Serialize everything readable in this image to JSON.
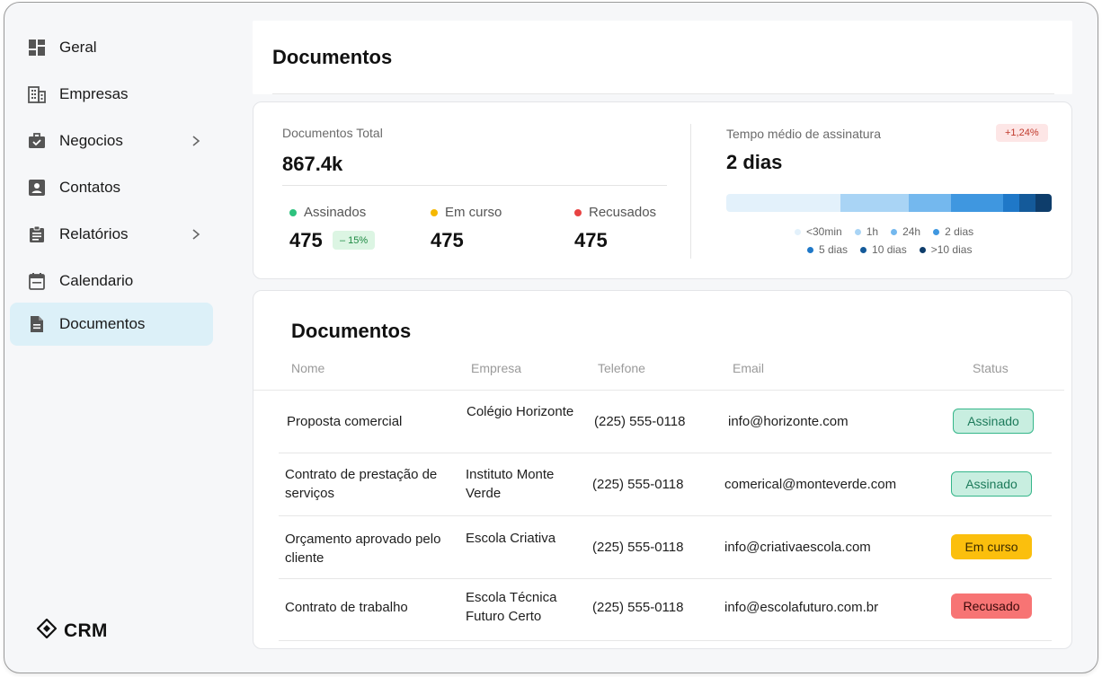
{
  "sidebar": {
    "items": [
      {
        "label": "Geral",
        "icon": "dashboard-icon"
      },
      {
        "label": "Empresas",
        "icon": "building-icon"
      },
      {
        "label": "Negocios",
        "icon": "briefcase-icon"
      },
      {
        "label": "Contatos",
        "icon": "contact-icon"
      },
      {
        "label": "Relatórios",
        "icon": "clipboard-icon"
      },
      {
        "label": "Calendario",
        "icon": "calendar-icon"
      },
      {
        "label": "Documentos",
        "icon": "document-icon"
      }
    ],
    "brand": "CRM"
  },
  "header": {
    "title": "Documentos"
  },
  "stats": {
    "total_label": "Documentos Total",
    "total_value": "867.4k",
    "assinados_label": "Assinados",
    "assinados_value": "475",
    "assinados_change": "– 15%",
    "emcurso_label": "Em curso",
    "emcurso_value": "475",
    "recusados_label": "Recusados",
    "recusados_value": "475",
    "tempo_label": "Tempo médio de assinatura",
    "tempo_value": "2 dias",
    "tempo_change": "+1,24%",
    "legend": [
      "<30min",
      "1h",
      "24h",
      "2 dias",
      "5 dias",
      "10 dias",
      ">10 dias"
    ],
    "segment_shares": [
      0.35,
      0.21,
      0.13,
      0.16,
      0.05,
      0.05,
      0.05
    ]
  },
  "table": {
    "title": "Documentos",
    "headers": [
      "Nome",
      "Empresa",
      "Telefone",
      "Email",
      "Status"
    ],
    "rows": [
      {
        "nome": "Proposta comercial",
        "empresa": "Colégio Horizonte",
        "telefone": "(225) 555-0118",
        "email": "info@horizonte.com",
        "status": "Assinado"
      },
      {
        "nome": "Contrato de prestação de serviços",
        "empresa": "Instituto Monte Verde",
        "telefone": "(225) 555-0118",
        "email": "comerical@monteverde.com",
        "status": "Assinado"
      },
      {
        "nome": "Orçamento aprovado pelo cliente",
        "empresa": "Escola Criativa",
        "telefone": "(225) 555-0118",
        "email": "info@criativaescola.com",
        "status": "Em curso"
      },
      {
        "nome": "Contrato de trabalho",
        "empresa": "Escola Técnica Futuro Certo",
        "telefone": "(225) 555-0118",
        "email": "info@escolafuturo.com.br",
        "status": "Recusado"
      }
    ]
  },
  "colors": {
    "active_nav": "#dcf0f8",
    "assinados_dot": "#2ec27e",
    "emcurso_dot": "#f5b800",
    "recusados_dot": "#e84343",
    "segments": [
      "#e3f1fb",
      "#a9d4f5",
      "#74b8ee",
      "#3f97e0",
      "#1f78c8",
      "#145a9a",
      "#0e3d6b"
    ]
  }
}
